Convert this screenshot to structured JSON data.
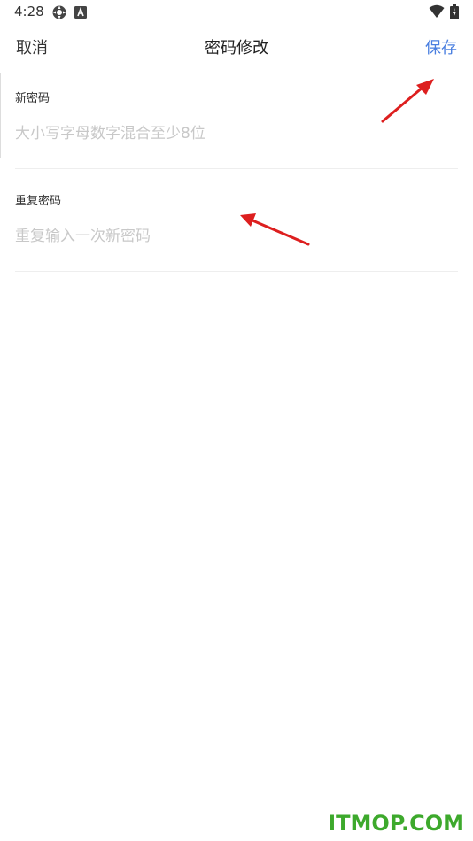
{
  "status_bar": {
    "time": "4:28",
    "icons": [
      "settings-gear-icon",
      "a-box-icon"
    ],
    "right_icons": [
      "wifi-icon",
      "battery-charging-icon"
    ]
  },
  "nav": {
    "cancel_label": "取消",
    "title": "密码修改",
    "save_label": "保存",
    "save_color": "#4a7fe0"
  },
  "form": {
    "new_password": {
      "label": "新密码",
      "placeholder": "大小写字母数字混合至少8位",
      "value": ""
    },
    "repeat_password": {
      "label": "重复密码",
      "placeholder": "重复输入一次新密码",
      "value": ""
    }
  },
  "annotations": {
    "arrow_color": "#dd1f1f"
  },
  "watermark": "ITMOP.COM"
}
